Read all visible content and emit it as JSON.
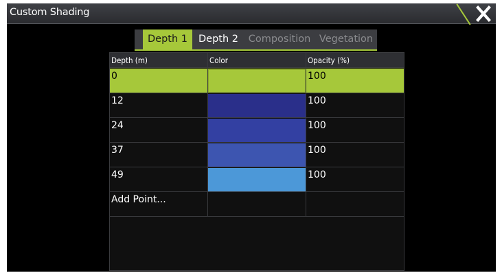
{
  "window": {
    "title": "Custom Shading",
    "close_icon": "close-icon"
  },
  "tabs": [
    {
      "label": "Depth 1",
      "state": "active"
    },
    {
      "label": "Depth 2",
      "state": "normal"
    },
    {
      "label": "Composition",
      "state": "disabled"
    },
    {
      "label": "Vegetation",
      "state": "disabled"
    }
  ],
  "table": {
    "headers": {
      "depth": "Depth (m)",
      "color": "Color",
      "opacity": "Opacity (%)"
    },
    "rows": [
      {
        "depth": "0",
        "color": "#a6c83a",
        "opacity": "100"
      },
      {
        "depth": "12",
        "color": "#2a2f8a",
        "opacity": "100"
      },
      {
        "depth": "24",
        "color": "#3340a2",
        "opacity": "100"
      },
      {
        "depth": "37",
        "color": "#3d55b0",
        "opacity": "100"
      },
      {
        "depth": "49",
        "color": "#4c98d8",
        "opacity": "100"
      }
    ],
    "add_point_label": "Add Point..."
  },
  "colors": {
    "accent": "#a6c83a",
    "background": "#000000",
    "titlebar": "#333439"
  }
}
